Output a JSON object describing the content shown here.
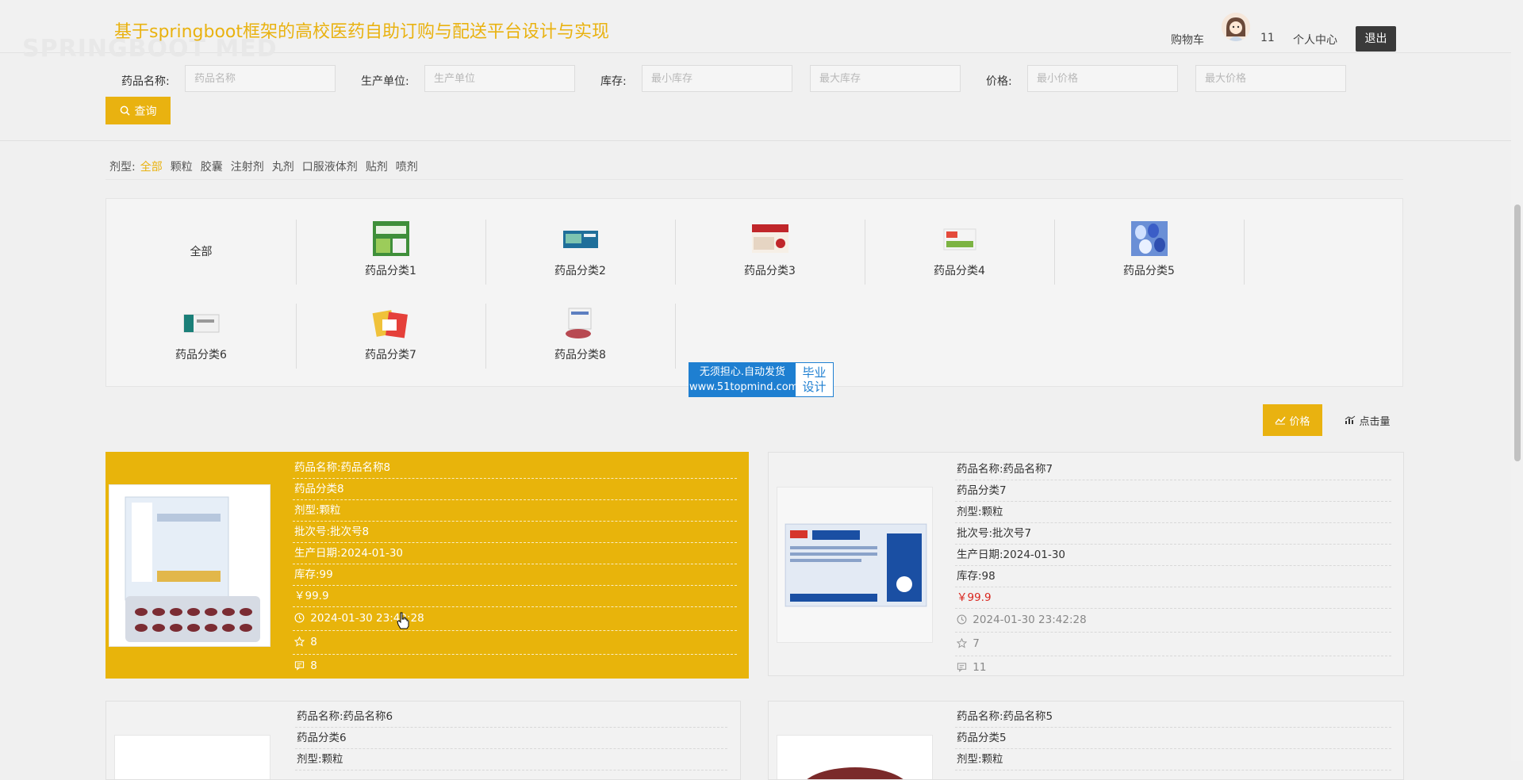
{
  "header": {
    "title": "基于springboot框架的高校医药自助订购与配送平台设计与实现",
    "cart": "购物车",
    "cart_count": "11",
    "profile": "个人中心",
    "logout": "退出"
  },
  "search": {
    "name_label": "药品名称:",
    "name_placeholder": "药品名称",
    "maker_label": "生产单位:",
    "maker_placeholder": "生产单位",
    "stock_label": "库存:",
    "stock_min_placeholder": "最小库存",
    "stock_max_placeholder": "最大库存",
    "price_label": "价格:",
    "price_min_placeholder": "最小价格",
    "price_max_placeholder": "最大价格",
    "query_label": "查询"
  },
  "dosage": {
    "label": "剂型:",
    "items": [
      "全部",
      "颗粒",
      "胶囊",
      "注射剂",
      "丸剂",
      "口服液体剂",
      "贴剂",
      "喷剂"
    ]
  },
  "categories": {
    "all": "全部",
    "items": [
      "药品分类1",
      "药品分类2",
      "药品分类3",
      "药品分类4",
      "药品分类5",
      "药品分类6",
      "药品分类7",
      "药品分类8"
    ]
  },
  "badge": {
    "line1": "无须担心.自动发货",
    "line2": "www.51topmind.com",
    "right1": "毕业",
    "right2": "设计"
  },
  "sort": {
    "price": "价格",
    "clicks": "点击量"
  },
  "products": [
    {
      "name": "药品名称:药品名称8",
      "category": "药品分类8",
      "dosage": "剂型:颗粒",
      "batch": "批次号:批次号8",
      "date": "生产日期:2024-01-30",
      "stock": "库存:99",
      "price": "￥99.9",
      "time": "2024-01-30 23:42:28",
      "favorites": "8",
      "comments": "8"
    },
    {
      "name": "药品名称:药品名称7",
      "category": "药品分类7",
      "dosage": "剂型:颗粒",
      "batch": "批次号:批次号7",
      "date": "生产日期:2024-01-30",
      "stock": "库存:98",
      "price": "￥99.9",
      "time": "2024-01-30 23:42:28",
      "favorites": "7",
      "comments": "11"
    },
    {
      "name": "药品名称:药品名称6",
      "category": "药品分类6",
      "dosage": "剂型:颗粒"
    },
    {
      "name": "药品名称:药品名称5",
      "category": "药品分类5",
      "dosage": "剂型:颗粒"
    }
  ],
  "icons": {
    "search": "search-icon",
    "price_trend": "trend-chart-icon",
    "clicks": "bar-chart-icon",
    "clock": "clock-icon",
    "star": "star-icon",
    "comment": "comment-icon"
  },
  "colors": {
    "accent": "#e9b210",
    "price_red": "#d9251d",
    "badge_blue": "#1e7fd1",
    "logout_bg": "#3a3a3a"
  }
}
